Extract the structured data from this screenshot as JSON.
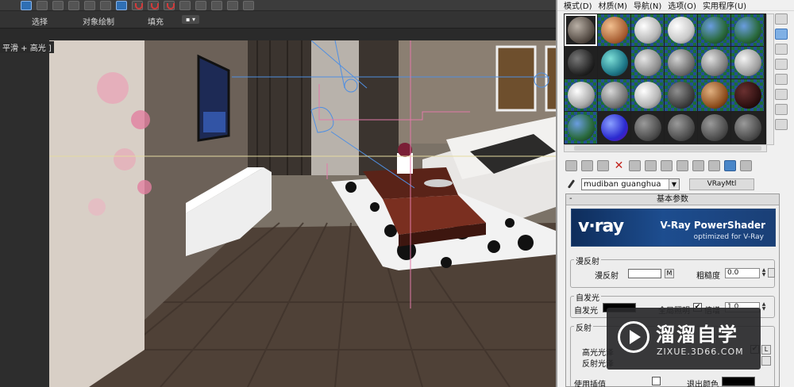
{
  "toolbar": {
    "tabs": [
      "选择",
      "对象绘制",
      "填充"
    ]
  },
  "viewport": {
    "label": "平滑 + 高光 ]"
  },
  "material_editor": {
    "menu": [
      "模式(D)",
      "材质(M)",
      "导航(N)",
      "选项(O)",
      "实用程序(U)"
    ],
    "material_name": "mudiban guanghua",
    "material_type": "VRayMtl",
    "rollout_title": "基本参数",
    "banner": {
      "logo": "v·ray",
      "title": "V-Ray PowerShader",
      "subtitle": "optimized for V-Ray"
    },
    "diffuse": {
      "group": "漫反射",
      "label": "漫反射",
      "map_button": "M",
      "roughness_label": "粗糙度",
      "roughness_value": "0.0",
      "color": "#ffffff"
    },
    "self_illum": {
      "group": "自发光",
      "label": "自发光",
      "gi_label": "全局照明",
      "mult_label": "倍增",
      "mult_value": "1.0",
      "color": "#000000"
    },
    "reflection": {
      "group": "反射",
      "hilight_label": "高光光泽",
      "refl_label": "反射光泽",
      "interp_label": "使用插值",
      "exit_label": "退出颜色",
      "lock_button": "L"
    }
  },
  "watermark": {
    "text": "溜溜自学",
    "url": "ZIXUE.3D66.COM"
  },
  "colors": {
    "accent": "#2f6fb4",
    "toolbar_bg": "#3c3c3c",
    "panel_bg": "#f0f0f0"
  }
}
